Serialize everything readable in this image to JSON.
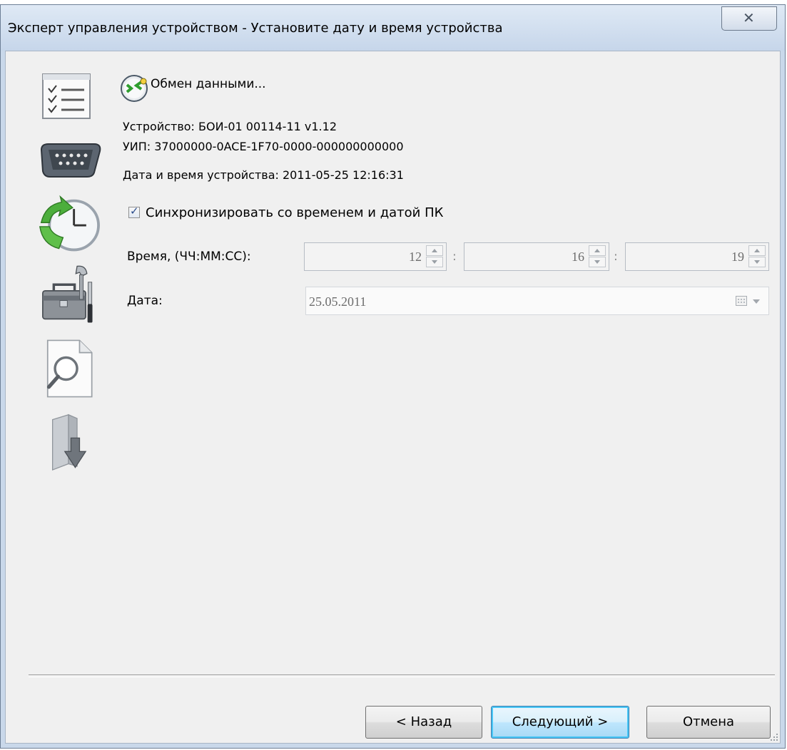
{
  "window": {
    "title": "Эксперт управления устройством - Установите дату и время устройства",
    "close_symbol": "✕"
  },
  "steps": [
    {
      "icon": "checklist-icon"
    },
    {
      "icon": "serial-port-icon"
    },
    {
      "icon": "clock-sync-icon"
    },
    {
      "icon": "toolbox-icon"
    },
    {
      "icon": "document-search-icon"
    },
    {
      "icon": "folder-download-icon"
    }
  ],
  "status": {
    "icon": "data-exchange-icon",
    "label": "Обмен данными..."
  },
  "device": {
    "name": "Устройство: БОИ-01 00114-11 v1.12",
    "uip": "УИП: 37000000-0ACE-1F70-0000-000000000000",
    "datetime": "Дата и время устройства: 2011-05-25 12:16:31"
  },
  "form": {
    "sync_label": "Синхронизировать со временем и датой ПК",
    "sync_checked": true,
    "time_label": "Время, (ЧЧ:ММ:СС):",
    "hours": "12",
    "minutes": "16",
    "seconds": "19",
    "separator": ":",
    "date_label": "Дата:",
    "date_value": "25.05.2011"
  },
  "buttons": {
    "back": "< Назад",
    "next": "Следующий >",
    "cancel": "Отмена"
  },
  "colors": {
    "titlebar": "#c9d8ea",
    "client": "#f0f0f0",
    "default_button_accent": "#48c6f5",
    "disabled_text": "#6d6d6d"
  }
}
